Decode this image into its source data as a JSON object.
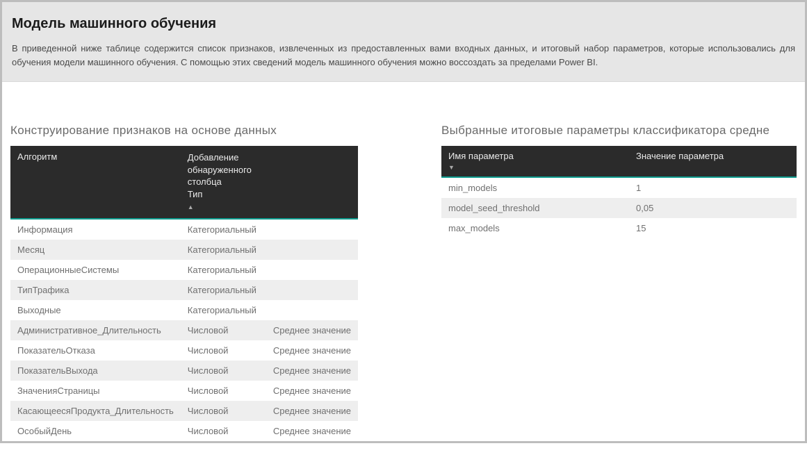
{
  "header": {
    "title": "Модель машинного обучения",
    "description": "В приведенной ниже таблице содержится список признаков, извлеченных из предоставленных вами входных данных, и итоговый набор параметров, которые использовались для обучения модели машинного обучения. С помощью этих сведений модель машинного обучения можно воссоздать за пределами Power BI."
  },
  "left": {
    "section_title": "Конструирование признаков на основе данных",
    "columns": {
      "c1": "Алгоритм",
      "c2_line1": "Добавление обнаруженного столбца",
      "c2_line2": "Тип",
      "c3": ""
    },
    "rows": [
      {
        "a": "Информация",
        "t": "Категориальный",
        "d": ""
      },
      {
        "a": "Месяц",
        "t": "Категориальный",
        "d": ""
      },
      {
        "a": "ОперационныеСистемы",
        "t": "Категориальный",
        "d": ""
      },
      {
        "a": "ТипТрафика",
        "t": "Категориальный",
        "d": ""
      },
      {
        "a": "Выходные",
        "t": "Категориальный",
        "d": ""
      },
      {
        "a": "Административное_Длительность",
        "t": "Числовой",
        "d": "Среднее значение"
      },
      {
        "a": "ПоказательОтказа",
        "t": "Числовой",
        "d": "Среднее значение"
      },
      {
        "a": "ПоказательВыхода",
        "t": "Числовой",
        "d": "Среднее значение"
      },
      {
        "a": "ЗначенияСтраницы",
        "t": "Числовой",
        "d": "Среднее значение"
      },
      {
        "a": "КасающеесяПродукта_Длительность",
        "t": "Числовой",
        "d": "Среднее значение"
      },
      {
        "a": "ОсобыйДень",
        "t": "Числовой",
        "d": "Среднее значение"
      }
    ]
  },
  "right": {
    "section_title": "Выбранные итоговые параметры классификатора средне",
    "columns": {
      "c1": "Имя параметра",
      "c2": "Значение параметра"
    },
    "rows": [
      {
        "n": "min_models",
        "v": "1"
      },
      {
        "n": "model_seed_threshold",
        "v": "0,05"
      },
      {
        "n": "max_models",
        "v": "15"
      }
    ]
  }
}
